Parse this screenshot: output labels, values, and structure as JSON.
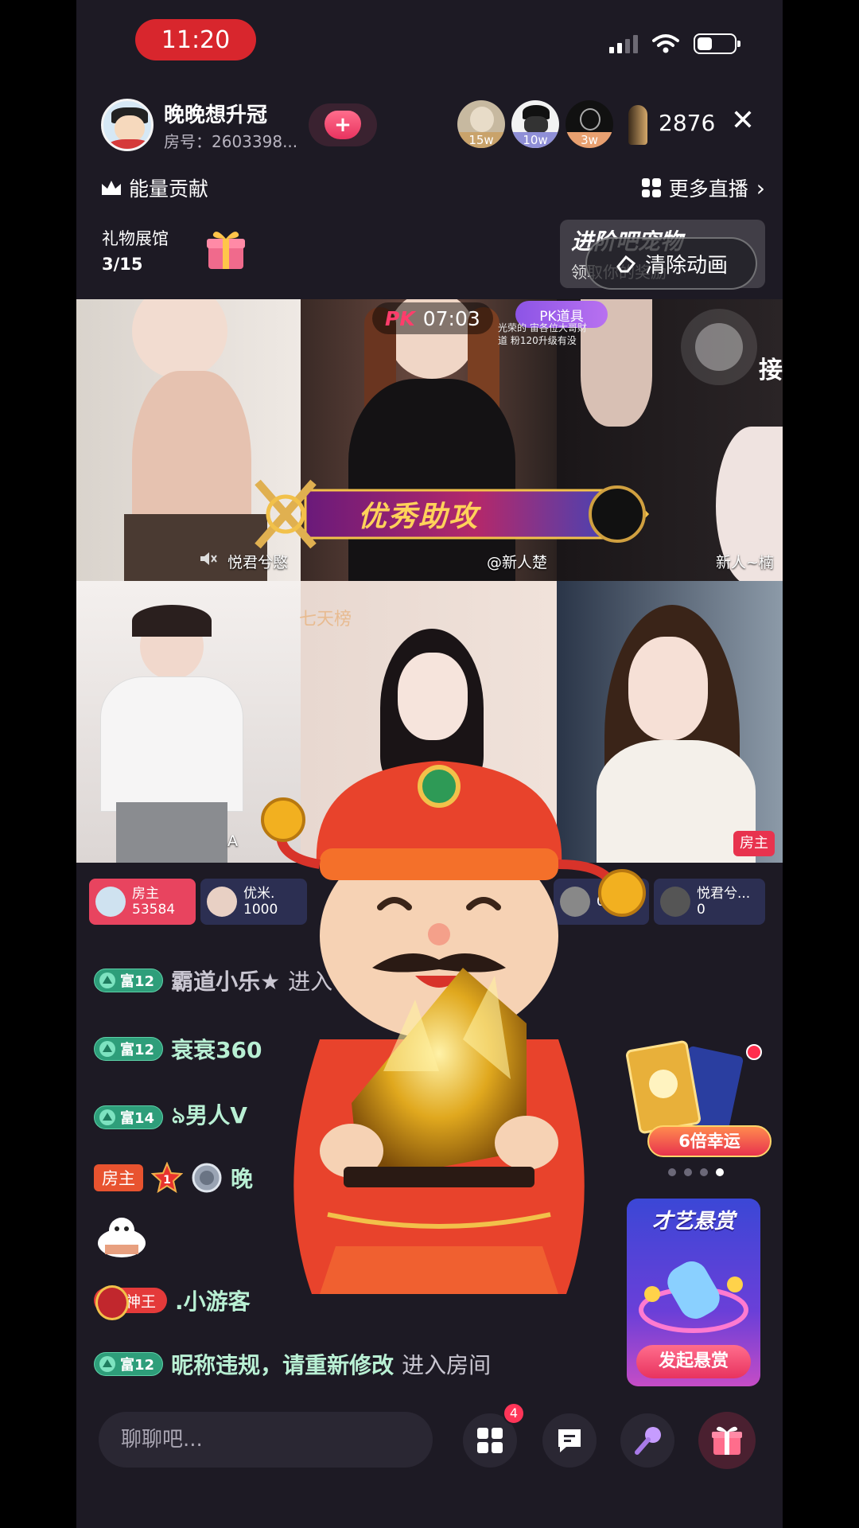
{
  "status_bar": {
    "time": "11:20"
  },
  "header": {
    "host_name": "晚晚想升冠",
    "room_no": "房号：2603398...",
    "viewers": [
      {
        "badge": "15w",
        "color": "#c9a36b"
      },
      {
        "badge": "10w",
        "color": "#8f8fd6"
      },
      {
        "badge": "3w",
        "color": "#e8a070"
      }
    ],
    "viewer_count": "2876"
  },
  "top_links": {
    "energy": "能量贡献",
    "more_live": "更多直播"
  },
  "gift_hall": {
    "label": "礼物展馆",
    "progress": "3/15"
  },
  "pet_card": {
    "title": "进阶吧宠物",
    "subtitle": "领取你的奖励"
  },
  "clear_animation": "清除动画",
  "pk": {
    "label": "PK",
    "timer": "07:03",
    "tools": "PK道具",
    "note": "光荣的 宙各位大哥财道 粉120升级有没",
    "side_char": "接",
    "assist_banner": "优秀助攻"
  },
  "tiles": [
    {
      "label": "悦君兮愍"
    },
    {
      "label": "@新人楚"
    },
    {
      "label": "新人~楠"
    },
    {
      "label": "A"
    },
    {
      "label": "七天榜"
    },
    {
      "label": "房主"
    }
  ],
  "scores": [
    {
      "name": "房主",
      "value": "53584"
    },
    {
      "name": "优米.",
      "value": "1000"
    },
    {
      "name": "",
      "value": "0"
    },
    {
      "name": "悦君兮...",
      "value": "0"
    }
  ],
  "chat": [
    {
      "level": "富12",
      "name": "霸道小乐★",
      "action": "进入"
    },
    {
      "level": "富12",
      "name": "衰衰360",
      "action": ""
    },
    {
      "level": "富14",
      "name": "৯男人V",
      "action": ""
    },
    {
      "host_badge": "房主",
      "rank": "1",
      "name": "晚"
    },
    {
      "god_badge": "神王",
      "name": ".小游客"
    },
    {
      "level": "富12",
      "name": "昵称违规，请重新修改",
      "action": "进入房间"
    }
  ],
  "side_panel": {
    "luck": "6倍幸运",
    "talent_title": "才艺悬赏",
    "talent_button": "发起悬赏"
  },
  "bottom_bar": {
    "placeholder": "聊聊吧...",
    "badge": "4"
  }
}
